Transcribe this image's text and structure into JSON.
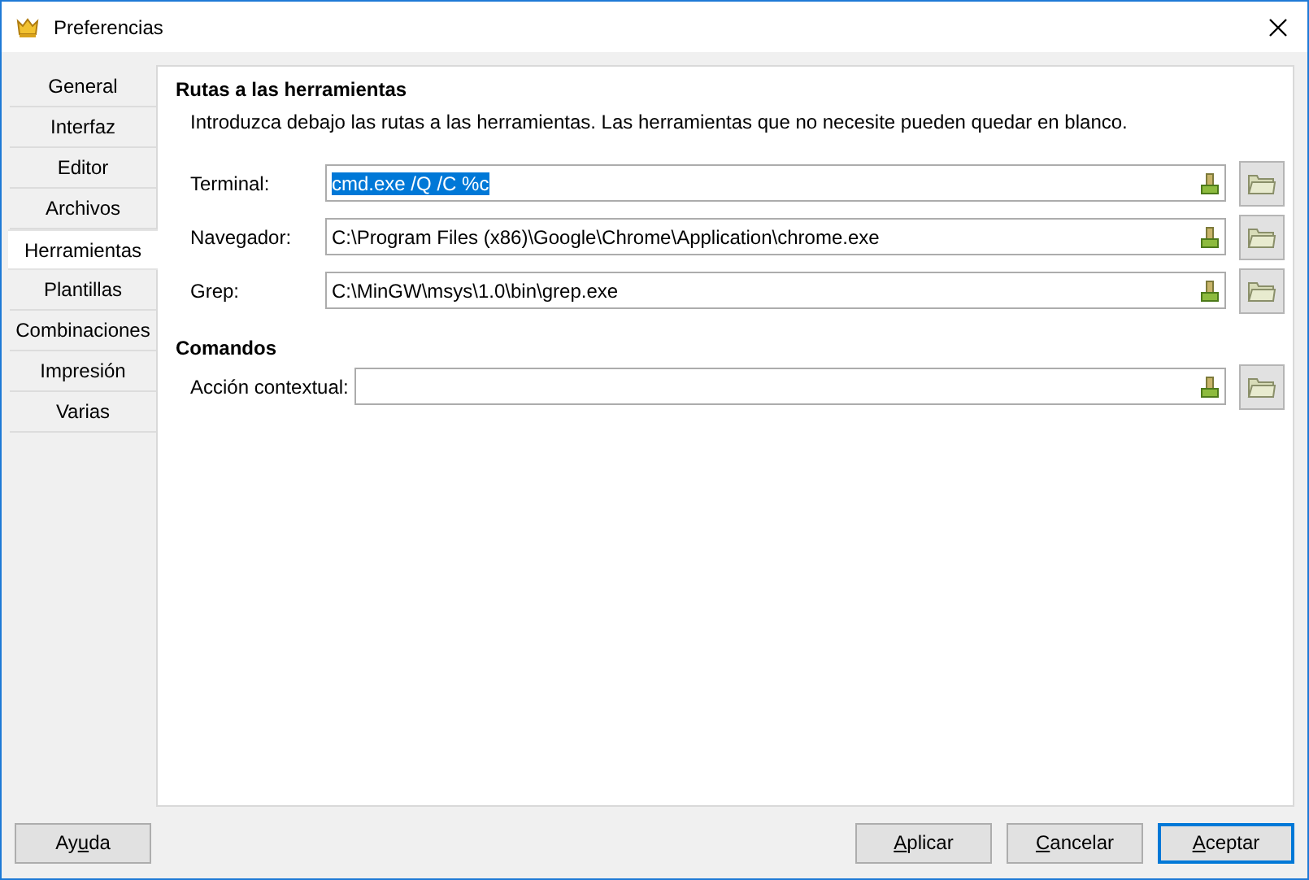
{
  "window": {
    "title": "Preferencias"
  },
  "sidebar": {
    "items": [
      {
        "label": "General",
        "selected": false
      },
      {
        "label": "Interfaz",
        "selected": false
      },
      {
        "label": "Editor",
        "selected": false
      },
      {
        "label": "Archivos",
        "selected": false
      },
      {
        "label": "Herramientas",
        "selected": true
      },
      {
        "label": "Plantillas",
        "selected": false
      },
      {
        "label": "Combinaciones",
        "selected": false
      },
      {
        "label": "Impresión",
        "selected": false
      },
      {
        "label": "Varias",
        "selected": false
      }
    ]
  },
  "sections": [
    {
      "title": "Rutas a las herramientas",
      "description": "Introduzca debajo las rutas a las herramientas. Las herramientas que no necesite pueden quedar en blanco.",
      "fields": [
        {
          "label": "Terminal:",
          "value": "cmd.exe /Q /C %c",
          "text_selected": true
        },
        {
          "label": "Navegador:",
          "value": "C:\\Program Files (x86)\\Google\\Chrome\\Application\\chrome.exe",
          "text_selected": false
        },
        {
          "label": "Grep:",
          "value": "C:\\MinGW\\msys\\1.0\\bin\\grep.exe",
          "text_selected": false
        }
      ]
    },
    {
      "title": "Comandos",
      "fields": [
        {
          "label": "Acción contextual:"
        }
      ]
    }
  ],
  "help_button": {
    "pre": "Ay",
    "key": "u",
    "post": "da"
  },
  "buttons": [
    {
      "key": "A",
      "post": "plicar",
      "default": false
    },
    {
      "key": "C",
      "post": "ancelar",
      "default": false
    },
    {
      "key": "A",
      "post": "ceptar",
      "default": true
    }
  ]
}
